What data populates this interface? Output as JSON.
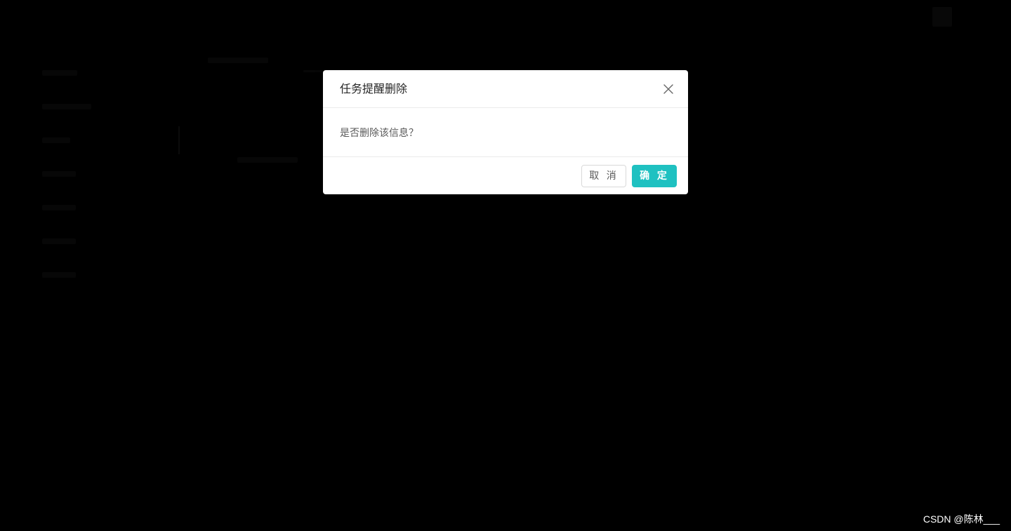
{
  "modal": {
    "title": "任务提醒删除",
    "message": "是否删除该信息？",
    "cancel_label": "取 消",
    "ok_label": "确 定",
    "close_icon": "close-icon",
    "accent_color": "#1fc1c1"
  },
  "watermark": {
    "text": "CSDN @陈林___"
  }
}
